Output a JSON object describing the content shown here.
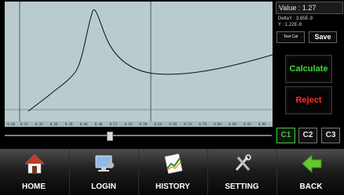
{
  "readout": {
    "value_text": "Value : 1.27",
    "delta_text": "DeltaY :  3.65E-9",
    "y_text": "Y : 1.22E-9"
  },
  "buttons": {
    "test_cal": "Test Cal",
    "save": "Save",
    "calculate": "Calculate",
    "reject": "Reject"
  },
  "channels": [
    "C1",
    "C2",
    "C3"
  ],
  "active_channel": "C1",
  "colors": {
    "calculate": "#3dd934",
    "reject": "#ff2d2d",
    "active_channel": "#37d62f"
  },
  "x_ticks": [
    "-0.40",
    "0.31",
    "0.33",
    "0.36",
    "0.39",
    "0.44",
    "0.48",
    "0.51",
    "0.54",
    "0.59",
    "0.64",
    "0.69",
    "0.74",
    "0.79",
    "0.84",
    "0.89",
    "0.94",
    "0.99"
  ],
  "slider_position": 0.39,
  "nav": [
    {
      "label": "HOME",
      "icon": "home-icon"
    },
    {
      "label": "LOGIN",
      "icon": "login-icon"
    },
    {
      "label": "HISTORY",
      "icon": "history-icon"
    },
    {
      "label": "SETTING",
      "icon": "setting-icon"
    },
    {
      "label": "BACK",
      "icon": "back-arrow-icon"
    }
  ]
}
